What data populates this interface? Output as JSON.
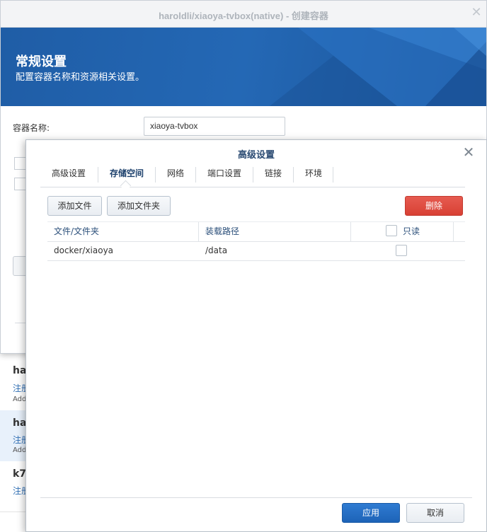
{
  "background_list": {
    "items": [
      {
        "title": "ha",
        "sub": "注册",
        "sub2": "Add"
      },
      {
        "title": "ha",
        "sub": "注册",
        "sub2": "Add"
      },
      {
        "title": "k7",
        "sub": "注册",
        "sub2": ""
      }
    ]
  },
  "create_window": {
    "title": "haroldli/xiaoya-tvbox(native) - 创建容器",
    "banner_title": "常规设置",
    "banner_subtitle": "配置容器名称和资源相关设置。",
    "name_label": "容器名称:",
    "name_value": "xiaoya-tvbox"
  },
  "advanced_dialog": {
    "title": "高级设置",
    "tabs": [
      {
        "label": "高级设置"
      },
      {
        "label": "存储空间"
      },
      {
        "label": "网络"
      },
      {
        "label": "端口设置"
      },
      {
        "label": "链接"
      },
      {
        "label": "环境"
      }
    ],
    "active_tab": "存储空间",
    "buttons": {
      "add_file": "添加文件",
      "add_folder": "添加文件夹",
      "delete": "删除",
      "apply": "应用",
      "cancel": "取消"
    },
    "table": {
      "headers": {
        "file": "文件/文件夹",
        "mount": "装载路径",
        "readonly": "只读"
      },
      "rows": [
        {
          "file": "docker/xiaoya",
          "mount": "/data",
          "readonly": false
        }
      ]
    }
  },
  "colors": {
    "banner": "#2366b3",
    "primary": "#1d63b7",
    "danger": "#d84034",
    "tab_active": "#1b3f6b"
  }
}
